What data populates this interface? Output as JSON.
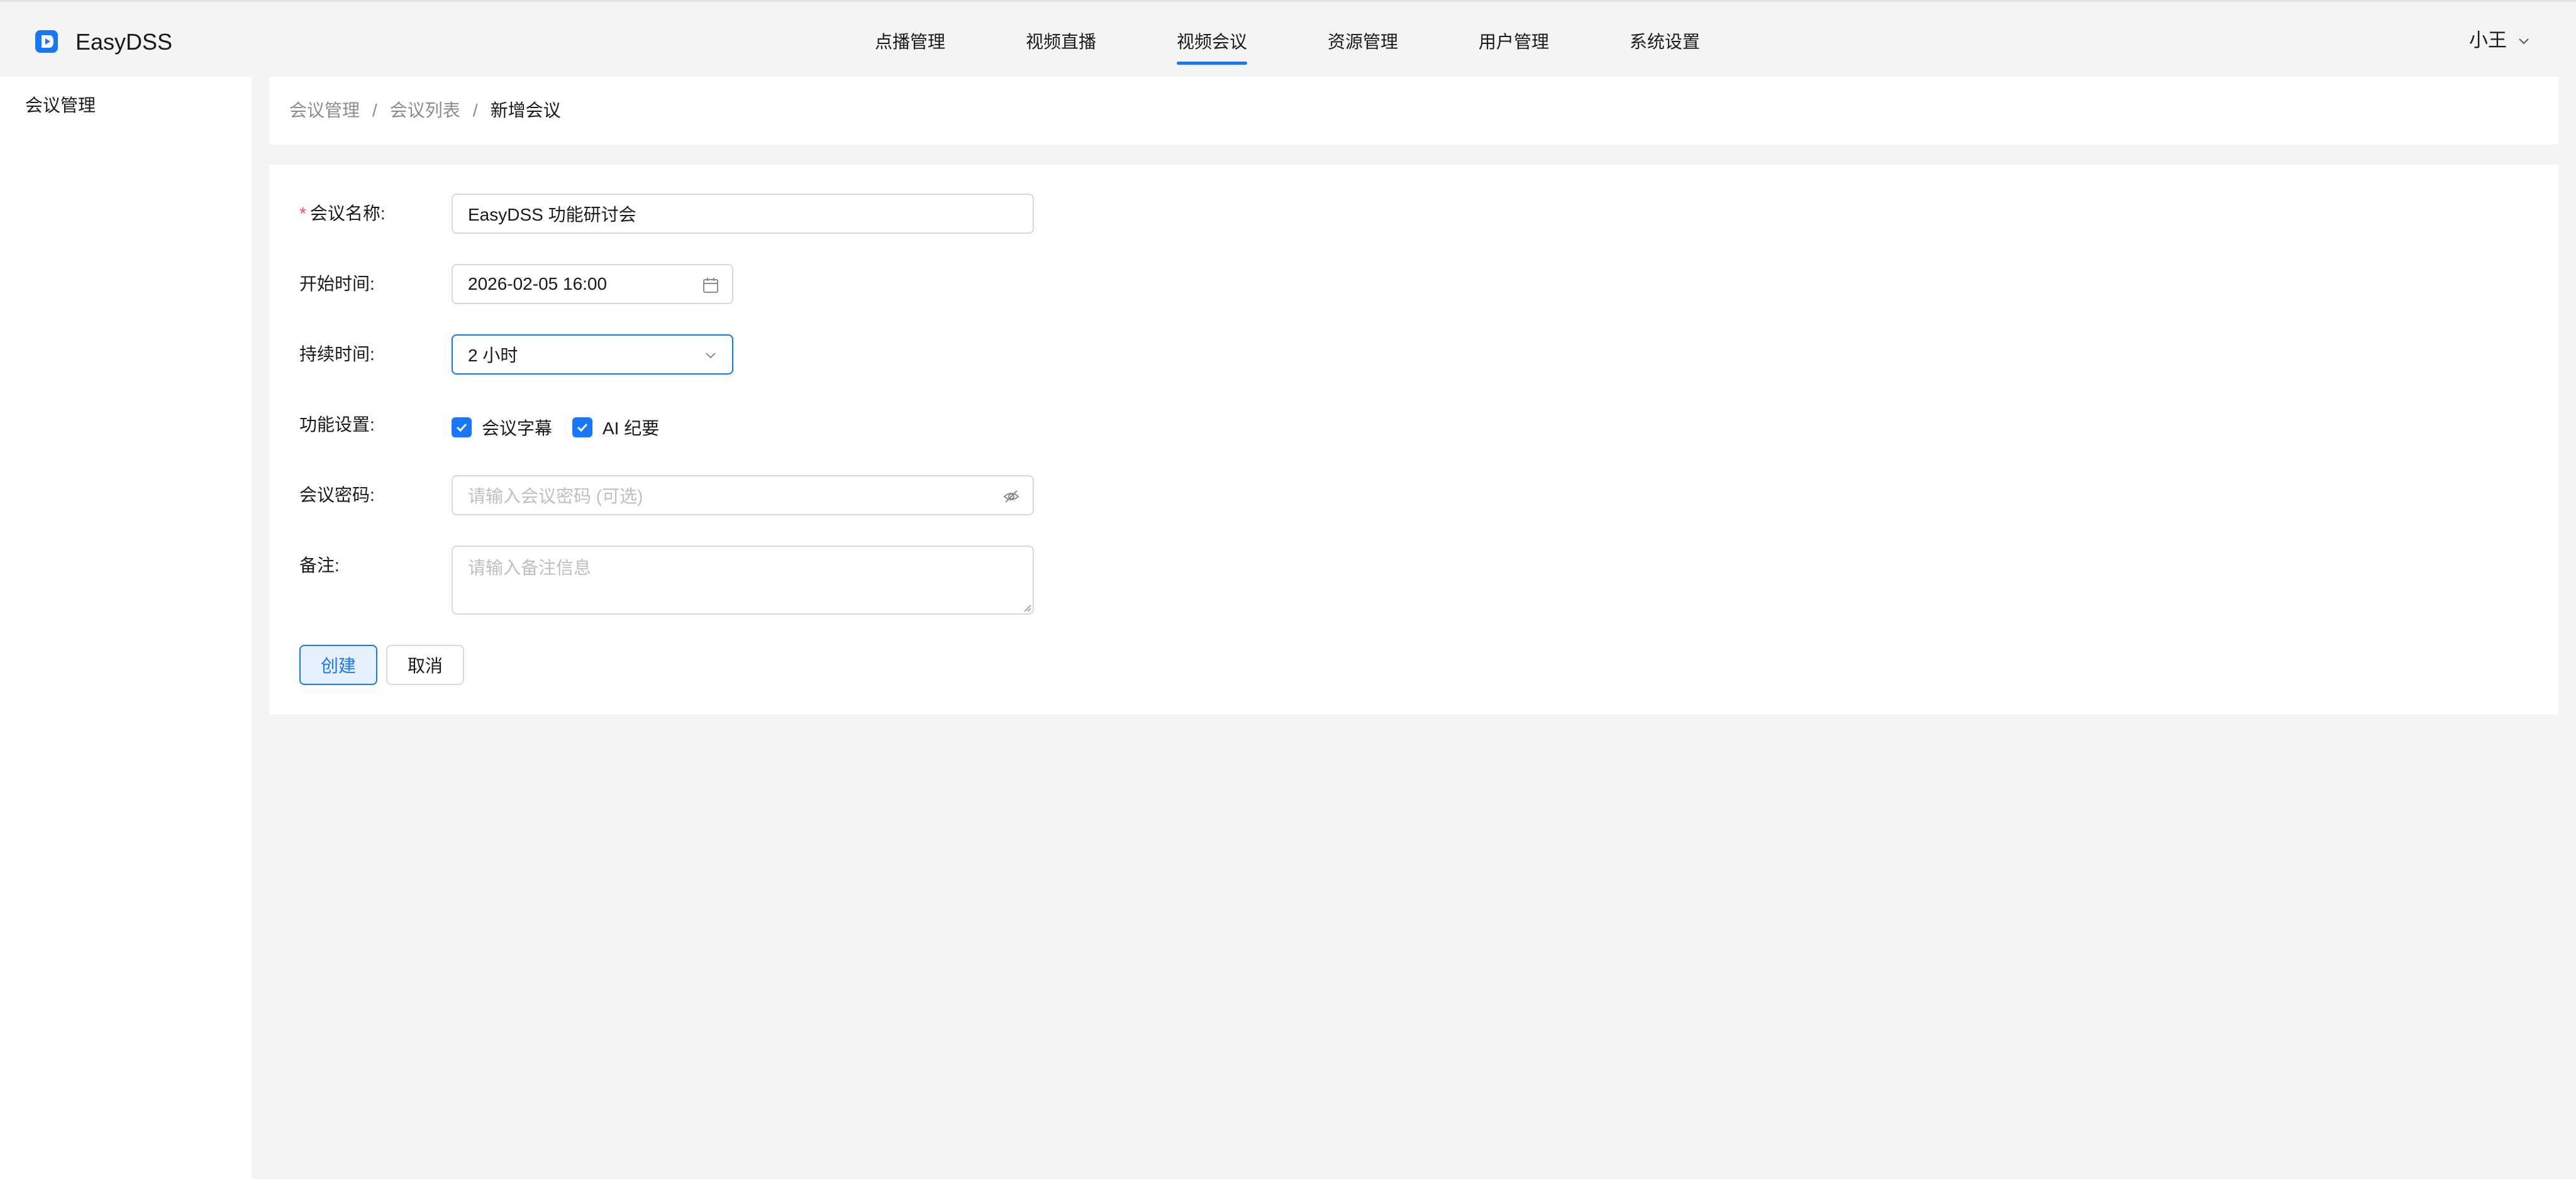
{
  "app": {
    "brand": "EasyDSS"
  },
  "nav": {
    "items": [
      {
        "label": "点播管理"
      },
      {
        "label": "视频直播"
      },
      {
        "label": "视频会议",
        "active": true
      },
      {
        "label": "资源管理"
      },
      {
        "label": "用户管理"
      },
      {
        "label": "系统设置"
      }
    ]
  },
  "user": {
    "name": "小王"
  },
  "sidebar": {
    "items": [
      {
        "label": "会议管理"
      }
    ]
  },
  "breadcrumb": {
    "items": [
      "会议管理",
      "会议列表",
      "新增会议"
    ],
    "separator": "/"
  },
  "form": {
    "name": {
      "label": "会议名称:",
      "required_mark": "*",
      "value": "EasyDSS 功能研讨会"
    },
    "start": {
      "label": "开始时间:",
      "value": "2026-02-05 16:00"
    },
    "duration": {
      "label": "持续时间:",
      "value": "2 小时"
    },
    "features": {
      "label": "功能设置:",
      "options": [
        {
          "label": "会议字幕",
          "checked": true
        },
        {
          "label": "AI 纪要",
          "checked": true
        }
      ]
    },
    "password": {
      "label": "会议密码:",
      "placeholder": "请输入会议密码 (可选)"
    },
    "notes": {
      "label": "备注:",
      "placeholder": "请输入备注信息"
    },
    "buttons": {
      "create": "创建",
      "cancel": "取消"
    }
  },
  "colors": {
    "accent": "#1677ff",
    "required": "#ff4d4f",
    "background": "#f4f4f4"
  },
  "icons": [
    "logo-icon",
    "user-chevron-down-icon",
    "calendar-icon",
    "select-chevron-down-icon",
    "eye-off-icon",
    "check-icon",
    "resize-icon"
  ]
}
